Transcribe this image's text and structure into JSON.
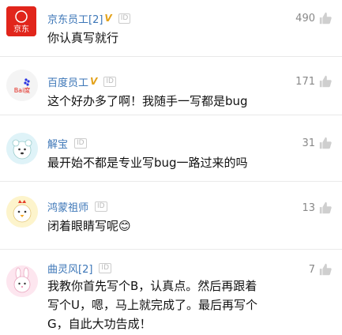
{
  "comments": [
    {
      "name": "京东员工[2]",
      "verified": "V",
      "id_tag": "ID",
      "lines": [
        "你认真写就行"
      ],
      "likes": "490"
    },
    {
      "name": "百度员工",
      "verified": "V",
      "id_tag": "ID",
      "lines": [
        "这个好办多了啊！我随手一写都是bug"
      ],
      "likes": "171"
    },
    {
      "name": "解宝",
      "verified": "",
      "id_tag": "ID",
      "lines": [
        "最开始不都是专业写bug一路过来的吗"
      ],
      "likes": "31"
    },
    {
      "name": "鸿蒙祖师",
      "verified": "",
      "id_tag": "ID",
      "lines": [
        "闭着眼睛写呢😊"
      ],
      "likes": "13"
    },
    {
      "name": "曲灵风[2]",
      "verified": "",
      "id_tag": "ID",
      "lines": [
        "我教你首先写个B，认真点。然后再跟着",
        "写个U，嗯，马上就完成了。最后再写个",
        "G，自此大功告成！"
      ],
      "likes": "7"
    }
  ],
  "logos": {
    "jd": "京东",
    "baidu": "Bai度"
  },
  "colors": {
    "name": "#3c76b7",
    "verified": "#e3a21a",
    "jd_red": "#e1251b",
    "baidu_blue": "#2932e1"
  }
}
